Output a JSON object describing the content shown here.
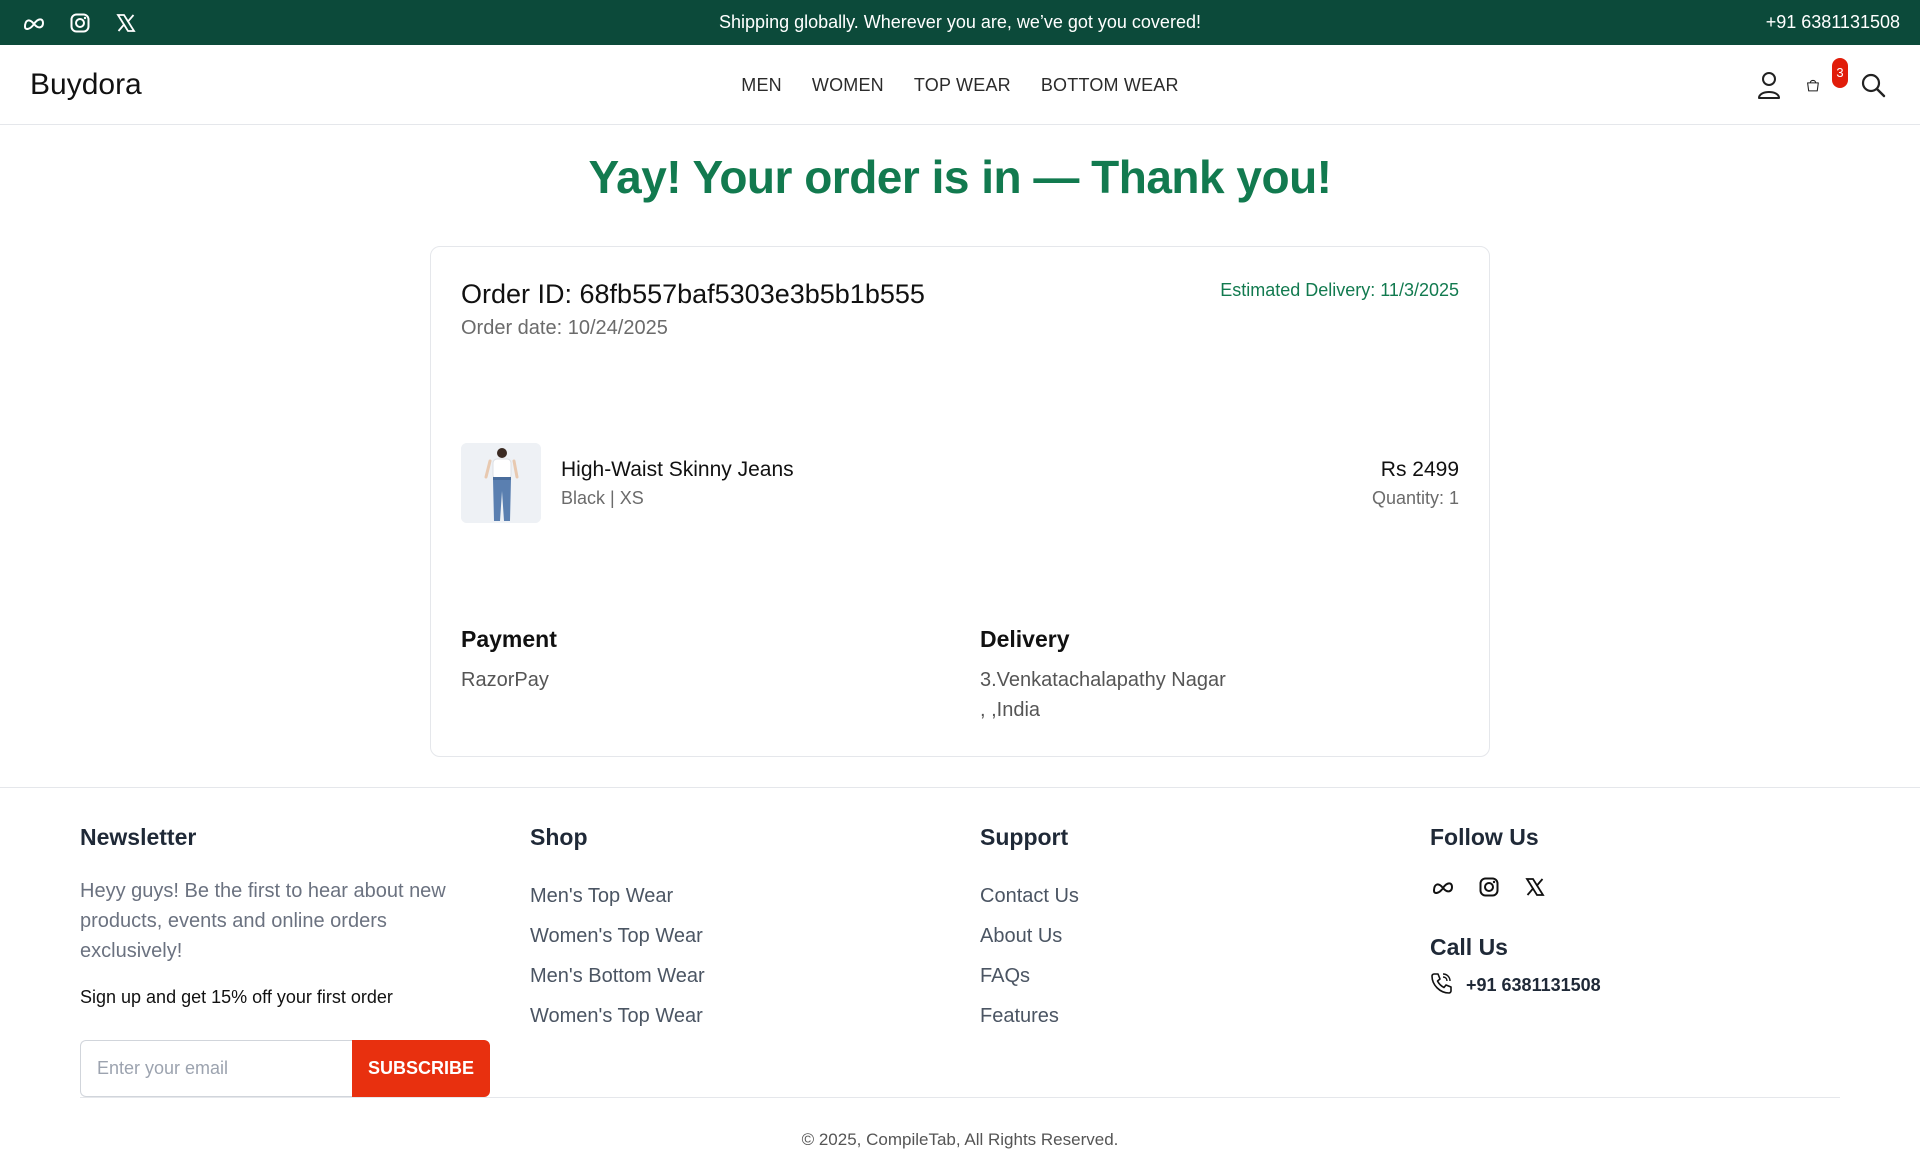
{
  "topbar": {
    "social_icons": [
      "meta-icon",
      "instagram-icon",
      "x-icon"
    ],
    "message": "Shipping globally. Wherever you are, we’ve got you covered!",
    "phone": "+91 6381131508"
  },
  "header": {
    "logo": "Buydora",
    "nav": [
      "MEN",
      "WOMEN",
      "TOP WEAR",
      "BOTTOM WEAR"
    ],
    "icons": [
      "user-icon",
      "cart-icon",
      "search-icon"
    ],
    "cart_count": "3"
  },
  "confirmation": {
    "heading": "Yay! Your order is in — Thank you!",
    "order_id": "Order ID: 68fb557baf5303e3b5b1b555",
    "order_date": "Order date: 10/24/2025",
    "estimated_delivery": "Estimated Delivery: 11/3/2025",
    "item": {
      "name": "High-Waist Skinny Jeans",
      "variant": "Black | XS",
      "price": "Rs 2499",
      "quantity": "Quantity: 1"
    },
    "payment": {
      "title": "Payment",
      "method": "RazorPay"
    },
    "delivery": {
      "title": "Delivery",
      "line1": "3.Venkatachalapathy Nagar",
      "line2": ", ,India"
    }
  },
  "footer": {
    "newsletter": {
      "title": "Newsletter",
      "text": "Heyy guys! Be the first to hear about new products, events and online orders exclusively!",
      "offer": "Sign up and get 15% off your first order",
      "email_placeholder": "Enter your email",
      "subscribe_label": "SUBSCRIBE"
    },
    "shop": {
      "title": "Shop",
      "links": [
        "Men's Top Wear",
        "Women's Top Wear",
        "Men's Bottom Wear",
        "Women's Top Wear"
      ]
    },
    "support": {
      "title": "Support",
      "links": [
        "Contact Us",
        "About Us",
        "FAQs",
        "Features"
      ]
    },
    "follow": {
      "title": "Follow Us",
      "icons": [
        "meta-icon",
        "instagram-icon",
        "x-icon"
      ]
    },
    "call": {
      "title": "Call Us",
      "phone": "+91 6381131508"
    },
    "copyright": "© 2025, CompileTab, All Rights Reserved."
  },
  "colors": {
    "topbar_bg": "#0c4a3a",
    "accent_green": "#127a4f",
    "subscribe_red": "#e8300f",
    "badge_red": "#e11d0a"
  }
}
